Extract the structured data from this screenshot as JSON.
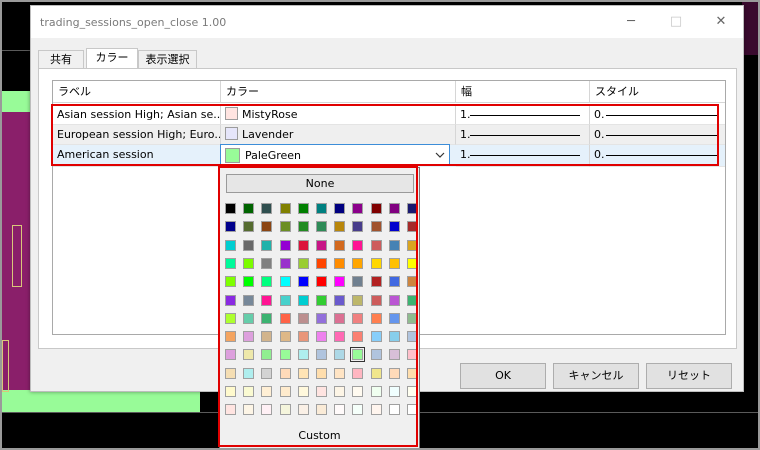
{
  "window": {
    "title": "trading_sessions_open_close 1.00",
    "minimize_glyph": "─",
    "maximize_glyph": "□",
    "close_glyph": "✕"
  },
  "tabs": [
    {
      "label": "共有"
    },
    {
      "label": "カラー",
      "active": true
    },
    {
      "label": "表示選択"
    }
  ],
  "table": {
    "headers": [
      "ラベル",
      "カラー",
      "幅",
      "スタイル"
    ],
    "rows": [
      {
        "label": "Asian session High; Asian se...",
        "color_name": "MistyRose",
        "color": "#ffe4e1",
        "width": "1.",
        "style": "0."
      },
      {
        "label": "European session High; Euro...",
        "color_name": "Lavender",
        "color": "#e6e6fa",
        "width": "1.",
        "style": "0."
      },
      {
        "label": "American session",
        "color_name": "PaleGreen",
        "color": "#98fb98",
        "width": "1.",
        "style": "0.",
        "selected": true
      }
    ],
    "dropdown_arrow": "chevron-down"
  },
  "buttons": {
    "ok": "OK",
    "cancel": "キャンセル",
    "reset": "リセット"
  },
  "color_picker": {
    "none_label": "None",
    "custom_label": "Custom",
    "selected_color": "#98fb98",
    "colors": [
      [
        "#000000",
        "#006400",
        "#2f4f4f",
        "#808000",
        "#008000",
        "#008080",
        "#000080",
        "#8b008b",
        "#800000",
        "#800080",
        "#191970"
      ],
      [
        "#00008b",
        "#556b2f",
        "#8b4513",
        "#6b8e23",
        "#228b22",
        "#2e8b57",
        "#b8860b",
        "#483d8b",
        "#a0522d",
        "#0000cd",
        "#a52a2a"
      ],
      [
        "#00ced1",
        "#696969",
        "#20b2aa",
        "#9400d3",
        "#dc143c",
        "#c71585",
        "#d2691e",
        "#ff1493",
        "#cd5c5c",
        "#4682b4",
        "#daa520"
      ],
      [
        "#00fa9a",
        "#7cfc00",
        "#808080",
        "#9932cc",
        "#9acd32",
        "#ff4500",
        "#ff8c00",
        "#ffa500",
        "#ffd700",
        "#ffc000",
        "#ffff00"
      ],
      [
        "#7fff00",
        "#00ff00",
        "#00ff7f",
        "#00ffff",
        "#0000ff",
        "#ff0000",
        "#ff00ff",
        "#708090",
        "#b22222",
        "#4169e1",
        "#cd853f"
      ],
      [
        "#8a2be2",
        "#778899",
        "#ff1493",
        "#48d1cc",
        "#00ced1",
        "#32cd32",
        "#6a5acd",
        "#bdb76b",
        "#cd5c5c",
        "#ba55d3",
        "#3cb371"
      ],
      [
        "#adff2f",
        "#66cdaa",
        "#3cb371",
        "#ff6347",
        "#bc8f8f",
        "#9370db",
        "#db7093",
        "#f08080",
        "#ff7f50",
        "#6495ed",
        "#8fbc8f"
      ],
      [
        "#f4a460",
        "#dda0dd",
        "#d2b48c",
        "#deb887",
        "#e9967a",
        "#ee82ee",
        "#ff69b4",
        "#fa8072",
        "#87cefa",
        "#87ceeb",
        "#b0c4de"
      ],
      [
        "#dda0dd",
        "#eee8aa",
        "#90ee90",
        "#98fb98",
        "#afeeee",
        "#b0c4de",
        "#add8e6",
        "#98fb98",
        "#b0c4de",
        "#d8bfd8",
        "#ffc0cb"
      ],
      [
        "#f5deb3",
        "#afeeee",
        "#d3d3d3",
        "#ffdab9",
        "#ffe4b5",
        "#ffdead",
        "#ffe4c4",
        "#ffb6c1",
        "#f0e68c",
        "#ffdab9",
        "#ffdead"
      ],
      [
        "#fffacd",
        "#fafad2",
        "#ffefd5",
        "#ffebcd",
        "#fff8dc",
        "#ffe4e1",
        "#fdf5e6",
        "#fffaf0",
        "#f0fff0",
        "#f0ffff",
        "#fffff0"
      ],
      [
        "#ffe4e1",
        "#fdf5e6",
        "#fff0f5",
        "#f5f5dc",
        "#faf0e6",
        "#faebd7",
        "#fffafa",
        "#f5fffa",
        "#fff5ee",
        "#ffffff",
        "#ffffff"
      ]
    ]
  }
}
